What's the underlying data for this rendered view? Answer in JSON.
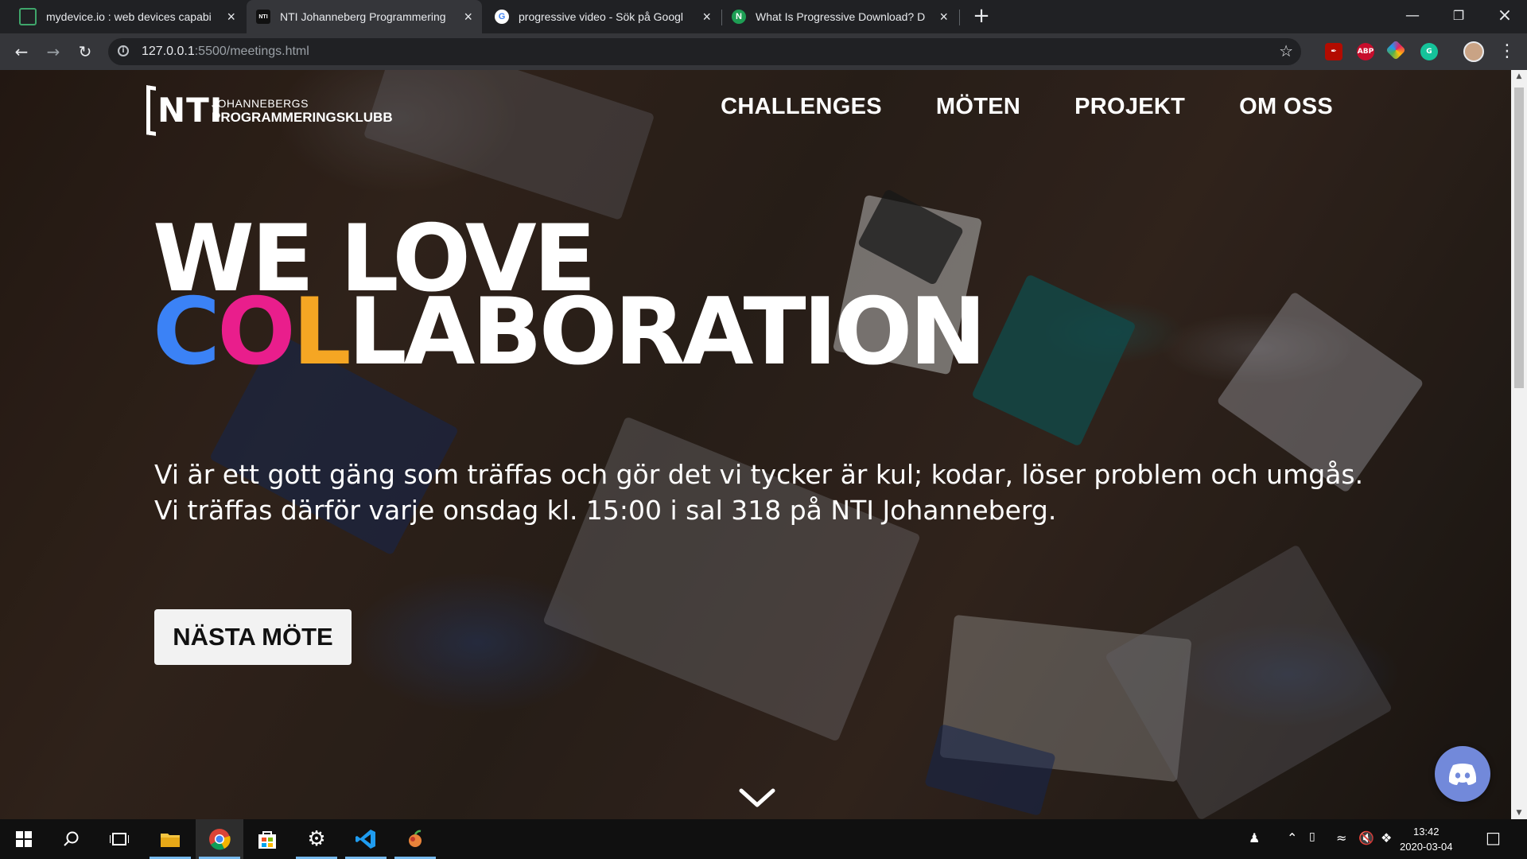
{
  "browser": {
    "tabs": [
      {
        "title": "mydevice.io : web devices capabi",
        "favicon": "mydevice-icon",
        "active": false
      },
      {
        "title": "NTI Johanneberg Programmering",
        "favicon": "nti-icon",
        "active": true
      },
      {
        "title": "progressive video - Sök på Googl",
        "favicon": "google-icon",
        "active": false
      },
      {
        "title": "What Is Progressive Download? D",
        "favicon": "n-icon",
        "active": false
      }
    ],
    "url_host": "127.0.0.1",
    "url_path": ":5500/meetings.html"
  },
  "site": {
    "logo": {
      "mark": "NTI",
      "line1": "JOHANNEBERGS",
      "line2": "PROGRAMMERINGSKLUBB"
    },
    "nav": [
      "CHALLENGES",
      "MÖTEN",
      "PROJEKT",
      "OM OSS"
    ],
    "hero": {
      "line1": "WE LOVE",
      "line2_colored": [
        "C",
        "O",
        "L"
      ],
      "line2_rest": "LABORATION",
      "text": "Vi är ett gott gäng som träffas och gör det vi tycker är kul; kodar, löser problem och umgås. Vi träffas därför varje onsdag kl. 15:00 i sal 318 på NTI Johanneberg.",
      "cta": "NÄSTA MÖTE"
    },
    "colors": {
      "blue": "#3b82f6",
      "pink": "#e91e8c",
      "orange": "#f5a623",
      "discord": "#7289da"
    }
  },
  "taskbar": {
    "apps": [
      "windows-start-icon",
      "search-icon",
      "task-view-icon",
      "file-explorer-icon",
      "chrome-icon",
      "store-icon",
      "settings-icon",
      "vscode-icon",
      "app-icon"
    ],
    "time": "13:42",
    "date": "2020-03-04"
  }
}
